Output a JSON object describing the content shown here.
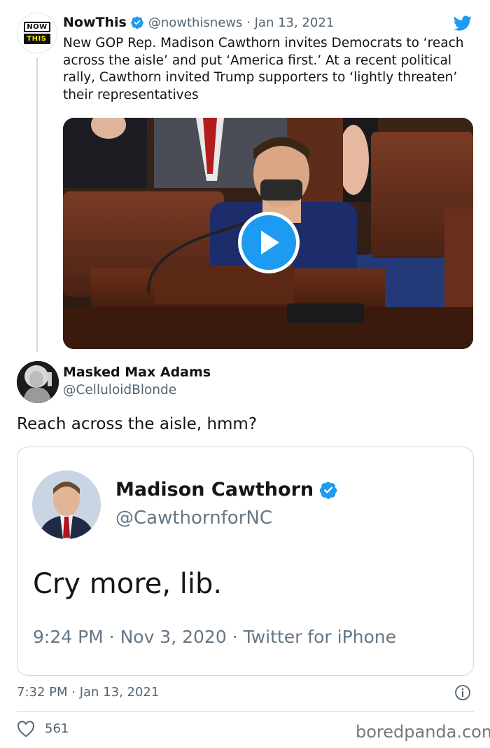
{
  "first_tweet": {
    "name": "NowThis",
    "handle": "@nowthisnews",
    "separator": "·",
    "date": "Jan 13, 2021",
    "logo_lines": [
      "NOW",
      "THIS"
    ],
    "text": "New GOP Rep. Madison Cawthorn invites Democrats to ‘reach across the aisle’ and put ‘America first.’ At a recent political rally, Cawthorn invited Trump supporters to ‘lightly threaten’ their representatives"
  },
  "reply_tweet": {
    "name": "Masked Max Adams",
    "handle": "@CelluloidBlonde",
    "text": "Reach across the aisle, hmm?",
    "timestamp": "7:32 PM · Jan 13, 2021",
    "likes": "561"
  },
  "embedded_tweet": {
    "name": "Madison Cawthorn",
    "handle": "@CawthornforNC",
    "text": "Cry more, lib.",
    "meta": "9:24 PM · Nov 3, 2020 · Twitter for iPhone"
  },
  "watermark": "boredpanda.com",
  "icons": {
    "twitter": "twitter-bird-icon",
    "verified": "verified-badge-icon",
    "play": "play-icon",
    "info": "info-icon",
    "like": "heart-icon"
  },
  "colors": {
    "accent": "#1d9bf0",
    "muted": "#536471",
    "border": "#cfd9de",
    "text": "#0f1419"
  }
}
